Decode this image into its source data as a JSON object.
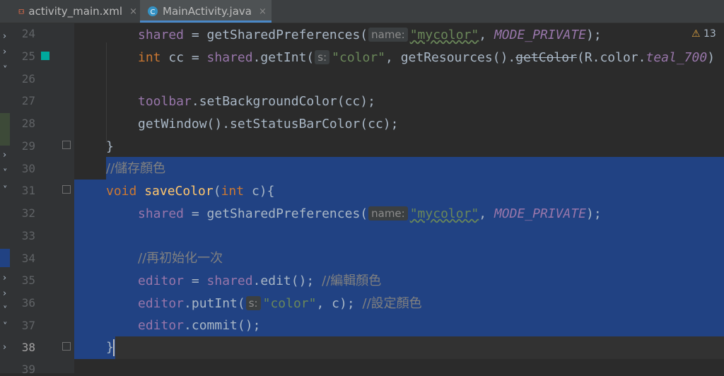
{
  "tabs": [
    {
      "label": "activity_main.xml",
      "icon": "xml-file-icon",
      "active": false,
      "close": "×"
    },
    {
      "label": "MainActivity.java",
      "icon": "class-icon",
      "active": true,
      "close": "×"
    }
  ],
  "warnings": {
    "icon": "warning-icon",
    "count": "13"
  },
  "colors": {
    "swatch": "#00a99d",
    "selection": "#214283",
    "tab_underline": "#4a88c7"
  },
  "lines": [
    {
      "n": "24"
    },
    {
      "n": "25"
    },
    {
      "n": "26"
    },
    {
      "n": "27"
    },
    {
      "n": "28"
    },
    {
      "n": "29"
    },
    {
      "n": "30"
    },
    {
      "n": "31"
    },
    {
      "n": "32"
    },
    {
      "n": "33"
    },
    {
      "n": "34"
    },
    {
      "n": "35"
    },
    {
      "n": "36"
    },
    {
      "n": "37"
    },
    {
      "n": "38"
    },
    {
      "n": "39"
    }
  ],
  "code": {
    "l24": {
      "field": "shared",
      "mid": " = getSharedPreferences(",
      "hint": "name:",
      "str": "\"mycolor\"",
      "comma": ", ",
      "const": "MODE_PRIVATE",
      "end": ");"
    },
    "l25": {
      "kw": "int",
      "mid": " cc = ",
      "field": "shared",
      "call": ".getInt(",
      "hint": "s:",
      "str": "\"color\"",
      "rest": ", getResources().",
      "strike": "getColor",
      "open": "(R.color.",
      "const": "teal_700",
      "end": ")"
    },
    "l27": {
      "field": "toolbar",
      "rest": ".setBackgroundColor(cc);"
    },
    "l28": {
      "text": "getWindow().setStatusBarColor(cc);"
    },
    "l29": {
      "text": "}"
    },
    "l30": {
      "comment": "//儲存顏色"
    },
    "l31": {
      "kw1": "void",
      "fn": "saveColor",
      "open": "(",
      "kw2": "int",
      "rest": " c){"
    },
    "l32": {
      "field": "shared",
      "mid": " = getSharedPreferences(",
      "hint": "name:",
      "str": "\"mycolor\"",
      "comma": ", ",
      "const": "MODE_PRIVATE",
      "end": ");"
    },
    "l34": {
      "comment": "//再初始化一次"
    },
    "l35": {
      "field1": "editor",
      "eq": " = ",
      "field2": "shared",
      "rest": ".edit(); ",
      "comment": "//編輯顏色"
    },
    "l36": {
      "field": "editor",
      "call": ".putInt(",
      "hint": "s:",
      "str": "\"color\"",
      "rest": ", c); ",
      "comment": "//設定顏色"
    },
    "l37": {
      "field": "editor",
      "rest": ".commit();"
    },
    "l38": {
      "text": "}"
    }
  }
}
